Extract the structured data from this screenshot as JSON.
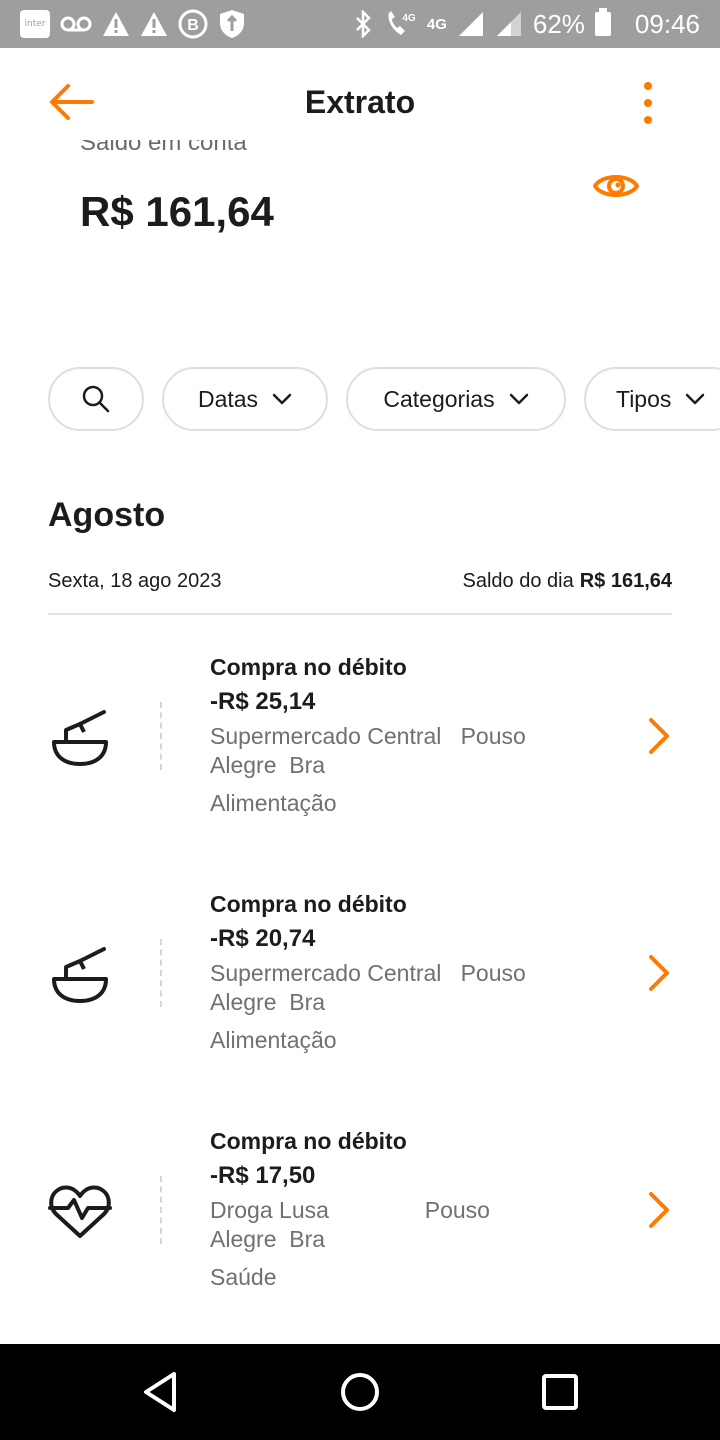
{
  "status_bar": {
    "carrier_app": "inter",
    "network": "4G",
    "battery": "62%",
    "time": "09:46"
  },
  "header": {
    "title": "Extrato"
  },
  "balance": {
    "label": "Saldo em conta",
    "value": "R$ 161,64"
  },
  "filters": {
    "datas": "Datas",
    "categorias": "Categorias",
    "tipos": "Tipos"
  },
  "month": "Agosto",
  "day": {
    "date": "Sexta, 18 ago 2023",
    "balance_label": "Saldo do dia",
    "balance_value": "R$ 161,64"
  },
  "transactions": [
    {
      "type": "Compra no débito",
      "amount": "-R$ 25,14",
      "description": "Supermercado Central   Pouso\nAlegre  Bra",
      "category": "Alimentação",
      "icon": "grocery-bowl-icon"
    },
    {
      "type": "Compra no débito",
      "amount": "-R$ 20,74",
      "description": "Supermercado Central   Pouso\nAlegre  Bra",
      "category": "Alimentação",
      "icon": "grocery-bowl-icon"
    },
    {
      "type": "Compra no débito",
      "amount": "-R$ 17,50",
      "description": "Droga Lusa               Pouso\nAlegre  Bra",
      "category": "Saúde",
      "icon": "health-heartbeat-icon"
    }
  ],
  "colors": {
    "accent": "#ff7a00",
    "status_bar": "#9e9e9e",
    "text": "#1c1c1c",
    "muted": "#707070"
  }
}
